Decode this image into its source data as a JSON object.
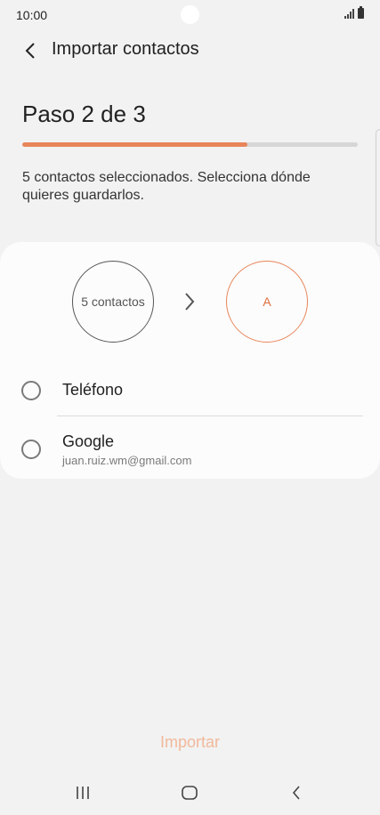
{
  "status_bar": {
    "time": "10:00"
  },
  "header": {
    "title": "Importar contactos"
  },
  "step": {
    "title": "Paso 2 de 3",
    "progress_percent": 67
  },
  "description": "5 contactos seleccionados. Selecciona dónde quieres guardarlos.",
  "transfer": {
    "from_label": "5 contactos",
    "to_label": "A"
  },
  "options": [
    {
      "label": "Teléfono",
      "selected": false
    },
    {
      "label": "Google",
      "sublabel": "juan.ruiz.wm@gmail.com",
      "selected": false
    }
  ],
  "import_button": {
    "label": "Importar"
  },
  "colors": {
    "accent": "#e8845a",
    "accent_disabled": "#f1b99b",
    "background": "#f2f2f2"
  },
  "icons": {
    "back": "chevron-left-icon",
    "transfer_arrow": "chevron-right-icon",
    "nav_recents": "recents-icon",
    "nav_home": "home-icon",
    "nav_back": "back-icon"
  }
}
